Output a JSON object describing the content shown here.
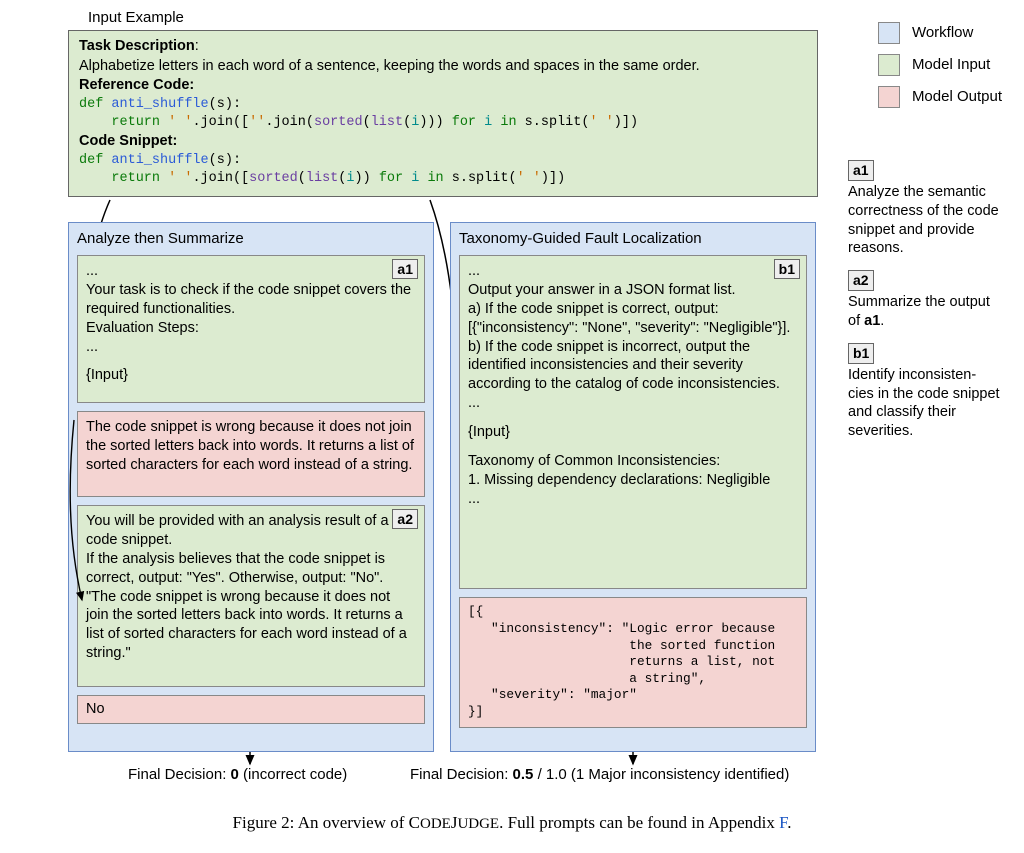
{
  "input_label": "Input Example",
  "legend": {
    "workflow": "Workflow",
    "model_input": "Model Input",
    "model_output": "Model Output"
  },
  "input_box": {
    "task_heading": "Task Description",
    "task_text": "Alphabetize letters in each word of a sentence, keeping the words and spaces in the same order.",
    "ref_heading": "Reference Code:",
    "snippet_heading": "Code Snippet:"
  },
  "left": {
    "title": "Analyze then Summarize",
    "a1": {
      "tag": "a1",
      "ell1": "...",
      "line1": "Your task is to check if the code snippet covers the required functionalities.",
      "line2": "Evaluation Steps:",
      "ell2": "...",
      "input_ph": "{Input}"
    },
    "red1": "The code snippet is wrong because it does not join the sorted letters back into words. It returns a list of sorted characters for each word instead of a string.",
    "a2": {
      "tag": "a2",
      "line1": "You will be provided with an analysis result of a code snippet.",
      "line2": "If the analysis believes that the code snippet is correct, output: \"Yes\". Otherwise, output: \"No\".",
      "line3": "\"The code snippet is wrong because it does not join the sorted letters back into words. It returns a list of sorted characters for each word instead of a string.\""
    },
    "red2": "No"
  },
  "right": {
    "title": "Taxonomy-Guided Fault Localization",
    "b1": {
      "tag": "b1",
      "ell1": "...",
      "line1": "Output your answer in a JSON format list.",
      "line2": "a) If the code snippet is correct, output: [{\"inconsistency\": \"None\", \"severity\": \"Negligible\"}].",
      "line3": "b) If the code snippet is incorrect, output the identified inconsistencies and their severity according to the catalog of code inconsistencies.",
      "ell2": "...",
      "input_ph": "{Input}",
      "tax_head": "Taxonomy of Common Inconsistencies:",
      "tax_item": "1. Missing dependency declarations: Negligible",
      "ell3": "..."
    },
    "red": {
      "l1": "[{",
      "l2": "   \"inconsistency\": \"Logic error because",
      "l3": "                     the sorted function",
      "l4": "                     returns a list, not",
      "l5": "                     a string\",",
      "l6": "   \"severity\": \"major\"",
      "l7": "}]"
    }
  },
  "sidebar": {
    "a1": {
      "tag": "a1",
      "desc": "Analyze the semantic correctness of the code snippet and provide reasons."
    },
    "a2": {
      "tag": "a2",
      "desc_pre": "Summarize the output of ",
      "desc_bold": "a1",
      "desc_post": "."
    },
    "b1": {
      "tag": "b1",
      "desc": "Identify inconsisten-\ncies in the code snippet and classify their severities."
    }
  },
  "final_left": {
    "prefix": "Final Decision: ",
    "bold": "0",
    "suffix": " (incorrect code)"
  },
  "final_right": {
    "prefix": "Final Decision: ",
    "bold": "0.5",
    "suffix": " / 1.0 (1 Major inconsistency identified)"
  },
  "caption": {
    "prefix": "Figure 2: An overview of ",
    "name1": "C",
    "name2": "ODE",
    "name3": "J",
    "name4": "UDGE",
    "middle": ". Full prompts can be found in Appendix ",
    "link": "F",
    "end": "."
  }
}
